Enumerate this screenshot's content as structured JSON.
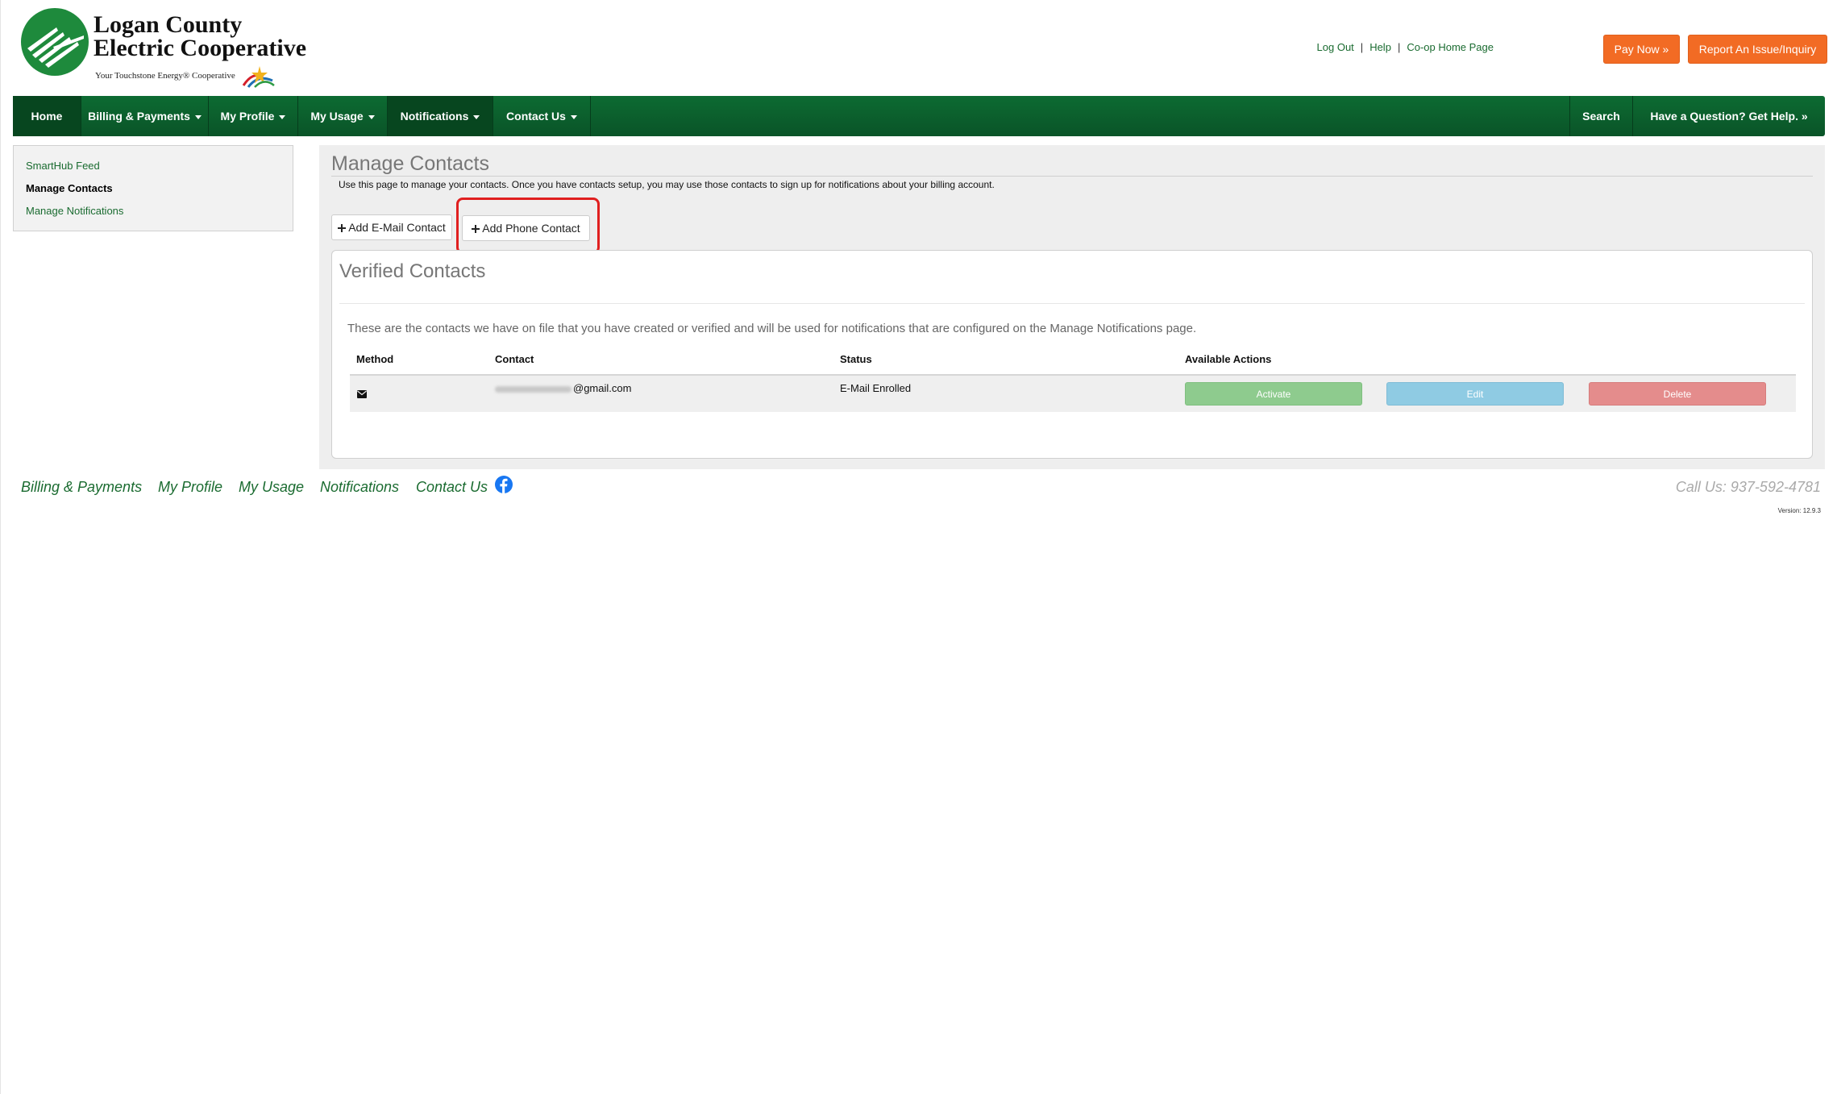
{
  "header": {
    "logo_line1": "Logan County",
    "logo_line2": "Electric Cooperative",
    "tagline": "Your Touchstone Energy® Cooperative",
    "links": [
      "Log Out",
      "Help",
      "Co-op Home Page"
    ],
    "pay_now": "Pay Now »",
    "report_issue": "Report An Issue/Inquiry"
  },
  "nav": {
    "home": "Home",
    "billing": "Billing & Payments",
    "profile": "My Profile",
    "usage": "My Usage",
    "notifications": "Notifications",
    "contact": "Contact Us",
    "search": "Search",
    "help": "Have a Question? Get Help. »"
  },
  "sidebar": {
    "items": [
      {
        "label": "SmartHub Feed"
      },
      {
        "label": "Manage Contacts"
      },
      {
        "label": "Manage Notifications"
      }
    ]
  },
  "main": {
    "title": "Manage Contacts",
    "intro": "Use this page to manage your contacts. Once you have contacts setup, you may use those contacts to sign up for notifications about your billing account.",
    "add_email": "Add E-Mail Contact",
    "add_phone": "Add Phone Contact",
    "verified": {
      "title": "Verified Contacts",
      "description": "These are the contacts we have on file that you have created or verified and will be used for notifications that are configured on the Manage Notifications page.",
      "columns": [
        "Method",
        "Contact",
        "Status",
        "Available Actions"
      ],
      "rows": [
        {
          "method_icon": "envelope-icon",
          "contact": "@gmail.com",
          "status": "E-Mail Enrolled",
          "actions": [
            "Activate",
            "Edit",
            "Delete"
          ]
        }
      ]
    }
  },
  "footer": {
    "links": [
      "Billing & Payments",
      "My Profile",
      "My Usage",
      "Notifications",
      "Contact Us"
    ],
    "call": "Call Us: 937-592-4781",
    "version": "Version: 12.9.3"
  },
  "colors": {
    "brand_green": "#0a5a2b",
    "accent_orange": "#f26b24",
    "activate": "#8ecb8e",
    "edit": "#8fcbe3",
    "delete": "#e48c8c",
    "highlight": "#e01f1f"
  }
}
